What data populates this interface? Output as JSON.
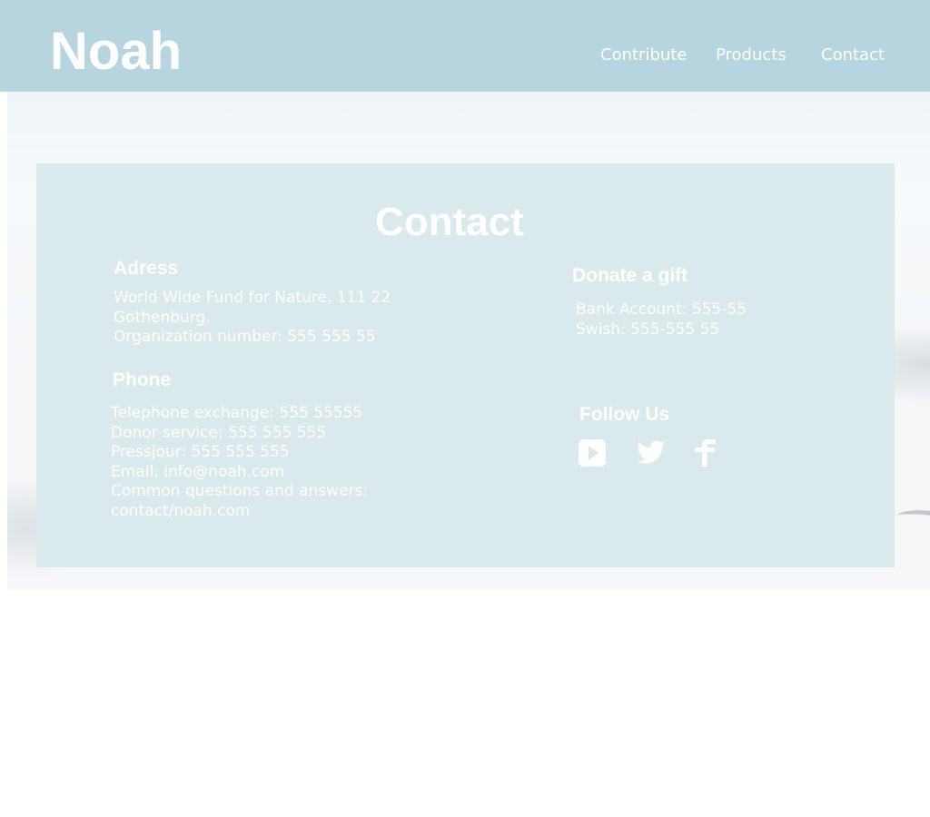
{
  "header": {
    "logo": "Noah",
    "nav": [
      "Contribute",
      "Products",
      "Contact"
    ]
  },
  "contact": {
    "title": "Contact",
    "address": {
      "heading": "Adress",
      "lines": [
        "World Wide Fund for Nature, 111 22",
        "Gothenburg.",
        "Organization number: 555 555 55"
      ]
    },
    "phone": {
      "heading": "Phone",
      "lines": [
        "Telephone exchange: 555 55555",
        "Donor service: 555 555 555",
        "Pressjour: 555 555 555",
        "Email: info@noah.com",
        "Common questions and answers:",
        "contact/noah.com"
      ]
    },
    "donate": {
      "heading": "Donate a gift",
      "lines": [
        "Bank Account: 555-55",
        "Swish: 555-555 55"
      ]
    },
    "follow": {
      "heading": "Follow Us",
      "icons": [
        "youtube-icon",
        "twitter-icon",
        "facebook-icon"
      ]
    }
  },
  "colors": {
    "header_bg": "#b6d5df",
    "card_bg": "#dae9eb",
    "text": "#ffffff"
  }
}
